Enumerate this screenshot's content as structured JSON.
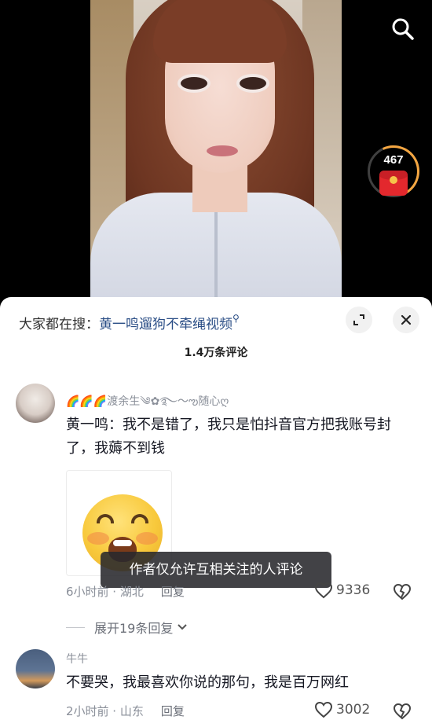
{
  "video": {
    "like_counter": "467"
  },
  "sheet": {
    "hot_search_prefix": "大家都在搜：",
    "hot_search_keyword": "黄一鸣遛狗不牵绳视频",
    "comment_count": "1.4万条评论"
  },
  "comments": [
    {
      "username": "🌈🌈🌈渡余生༄✿࿐～ఌ随心ღ",
      "text": "黄一鸣：我不是错了，我只是怕抖音官方把我账号封了，我薅不到钱",
      "tooltip": "作者仅允许互相关注的人评论",
      "time_location": "6小时前 · 湖北",
      "reply_label": "回复",
      "likes": "9336",
      "expand_label": "展开19条回复"
    },
    {
      "username": "牛牛",
      "text": "不要哭，我最喜欢你说的那句，我是百万网红",
      "time_location": "2小时前 · 山东",
      "reply_label": "回复",
      "likes": "3002"
    }
  ]
}
